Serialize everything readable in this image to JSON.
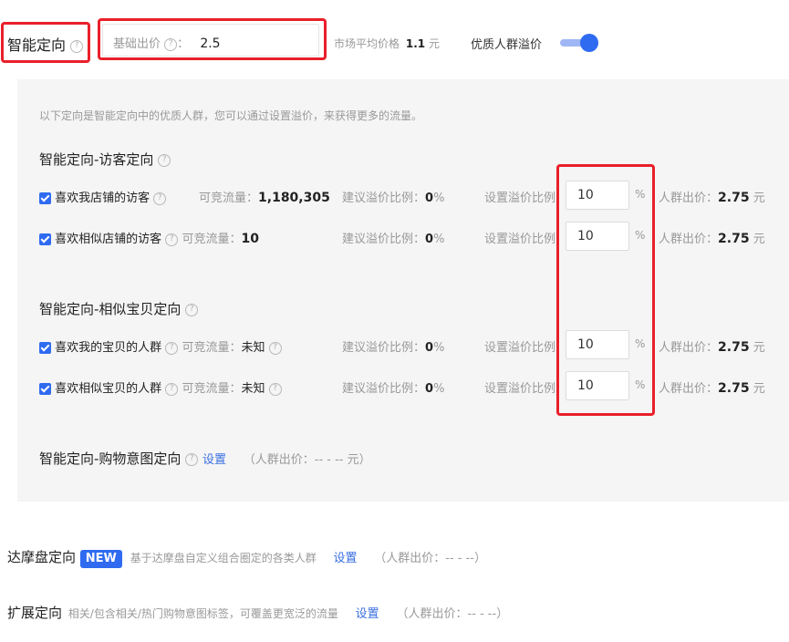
{
  "header": {
    "title": "智能定向",
    "base_bid_label": "基础出价",
    "base_bid_value": "2.5",
    "market_avg_label": "市场平均价格",
    "market_avg_value": "1.1",
    "market_avg_unit": "元",
    "premium_toggle_label": "优质人群溢价"
  },
  "panel": {
    "intro": "以下定向是智能定向中的优质人群，您可以通过设置溢价，来获得更多的流量。",
    "section1_title": "智能定向-访客定向",
    "section2_title": "智能定向-相似宝贝定向",
    "section3_title": "智能定向-购物意图定向",
    "section3_link": "设置",
    "section3_bid": "（人群出价：-- - -- 元）",
    "rows": [
      {
        "name": "喜欢我店铺的访客",
        "traffic_label": "可竞流量：",
        "traffic": "1,180,305",
        "suggest_label": "建议溢价比例：",
        "suggest": "0",
        "pct": "%",
        "set_label": "设置溢价比例",
        "input": "10",
        "bid_label": "人群出价：",
        "bid": "2.75",
        "unit": "元"
      },
      {
        "name": "喜欢相似店铺的访客",
        "traffic_label": "可竞流量：",
        "traffic": "10",
        "suggest_label": "建议溢价比例：",
        "suggest": "0",
        "pct": "%",
        "set_label": "设置溢价比例",
        "input": "10",
        "bid_label": "人群出价：",
        "bid": "2.75",
        "unit": "元"
      },
      {
        "name": "喜欢我的宝贝的人群",
        "traffic_label": "可竞流量：",
        "traffic": "未知",
        "suggest_label": "建议溢价比例：",
        "suggest": "0",
        "pct": "%",
        "set_label": "设置溢价比例",
        "input": "10",
        "bid_label": "人群出价：",
        "bid": "2.75",
        "unit": "元"
      },
      {
        "name": "喜欢相似宝贝的人群",
        "traffic_label": "可竞流量：",
        "traffic": "未知",
        "suggest_label": "建议溢价比例：",
        "suggest": "0",
        "pct": "%",
        "set_label": "设置溢价比例",
        "input": "10",
        "bid_label": "人群出价：",
        "bid": "2.75",
        "unit": "元"
      }
    ]
  },
  "damo": {
    "title": "达摩盘定向",
    "badge": "NEW",
    "desc": "基于达摩盘自定义组合圈定的各类人群",
    "link": "设置",
    "bid": "（人群出价：-- - --）"
  },
  "extend": {
    "title": "扩展定向",
    "desc": "相关/包含相关/热门购物意图标签，可覆盖更宽泛的流量",
    "link": "设置",
    "bid": "（人群出价：-- - --）"
  },
  "colors": {
    "accent": "#2f6bf0",
    "highlight_box": "#e8202a",
    "panel_bg": "#f5f5f5"
  }
}
